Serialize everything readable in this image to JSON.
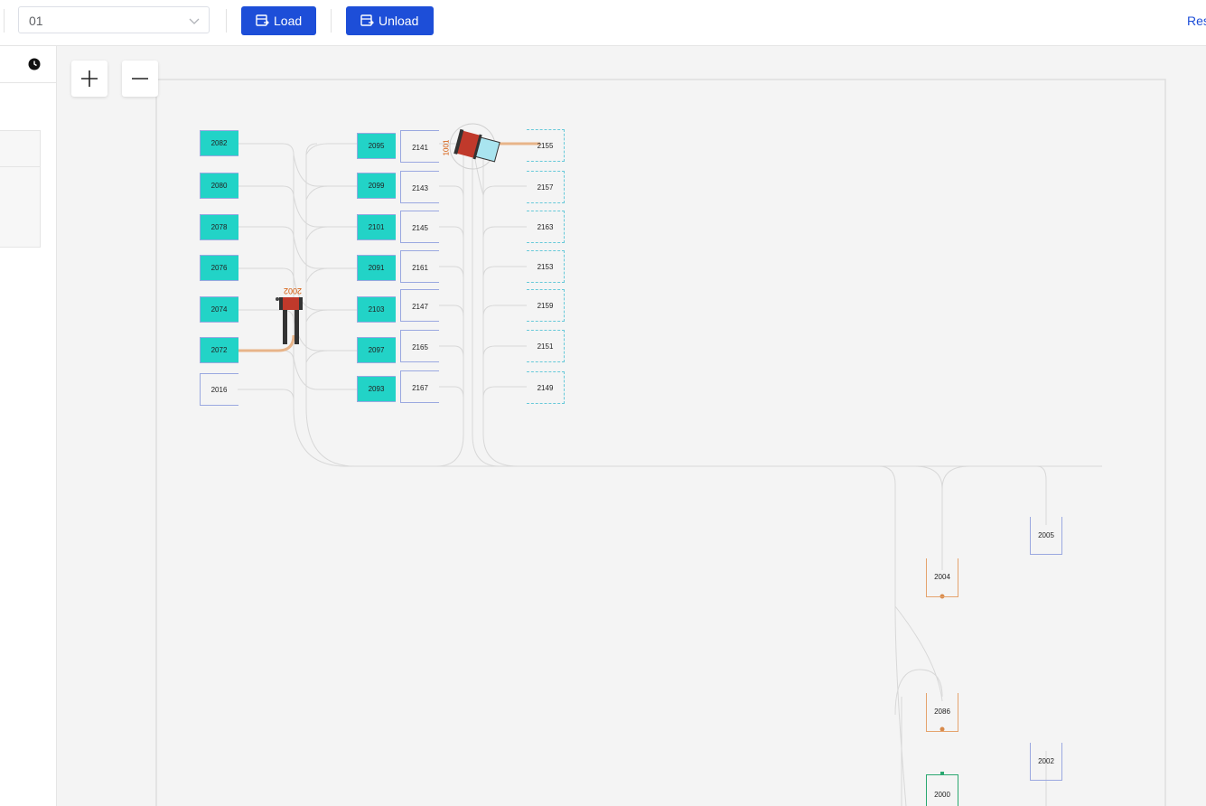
{
  "toolbar": {
    "select_value": "01",
    "load_label": "Load",
    "unload_label": "Unload",
    "reset_label": "Res",
    "accent": "#1d4ed8"
  },
  "sidebar": {
    "clock_icon": "clock-icon"
  },
  "map": {
    "zoom_in_icon": "plus-icon",
    "zoom_out_icon": "minus-icon",
    "colors": {
      "occupied": "#22d3c7",
      "slot_border": "#9aa8e0",
      "dashed_border": "#67c9d9",
      "orange": "#e5a36d",
      "path": "#d6d6d6",
      "robot": "#c0392b"
    },
    "robots": [
      {
        "id": "2002",
        "label": "2002"
      },
      {
        "id": "1001",
        "label": "1001"
      }
    ],
    "col1": [
      {
        "label": "2082",
        "occupied": true
      },
      {
        "label": "2080",
        "occupied": true
      },
      {
        "label": "2078",
        "occupied": true
      },
      {
        "label": "2076",
        "occupied": true
      },
      {
        "label": "2074",
        "occupied": true
      },
      {
        "label": "2072",
        "occupied": true
      },
      {
        "label": "2016",
        "occupied": false
      }
    ],
    "col2": [
      {
        "label": "2095",
        "occupied": true
      },
      {
        "label": "2099",
        "occupied": true
      },
      {
        "label": "2101",
        "occupied": true
      },
      {
        "label": "2091",
        "occupied": true
      },
      {
        "label": "2103",
        "occupied": true
      },
      {
        "label": "2097",
        "occupied": true
      },
      {
        "label": "2093",
        "occupied": true
      }
    ],
    "col3": [
      {
        "label": "2141"
      },
      {
        "label": "2143"
      },
      {
        "label": "2145"
      },
      {
        "label": "2161"
      },
      {
        "label": "2147"
      },
      {
        "label": "2165"
      },
      {
        "label": "2167"
      }
    ],
    "col4": [
      {
        "label": "2155"
      },
      {
        "label": "2157"
      },
      {
        "label": "2163"
      },
      {
        "label": "2153"
      },
      {
        "label": "2159"
      },
      {
        "label": "2151"
      },
      {
        "label": "2149"
      }
    ],
    "stations": {
      "s2005": "2005",
      "s2004": "2004",
      "s2086": "2086",
      "s2002": "2002",
      "s2000": "2000"
    }
  }
}
